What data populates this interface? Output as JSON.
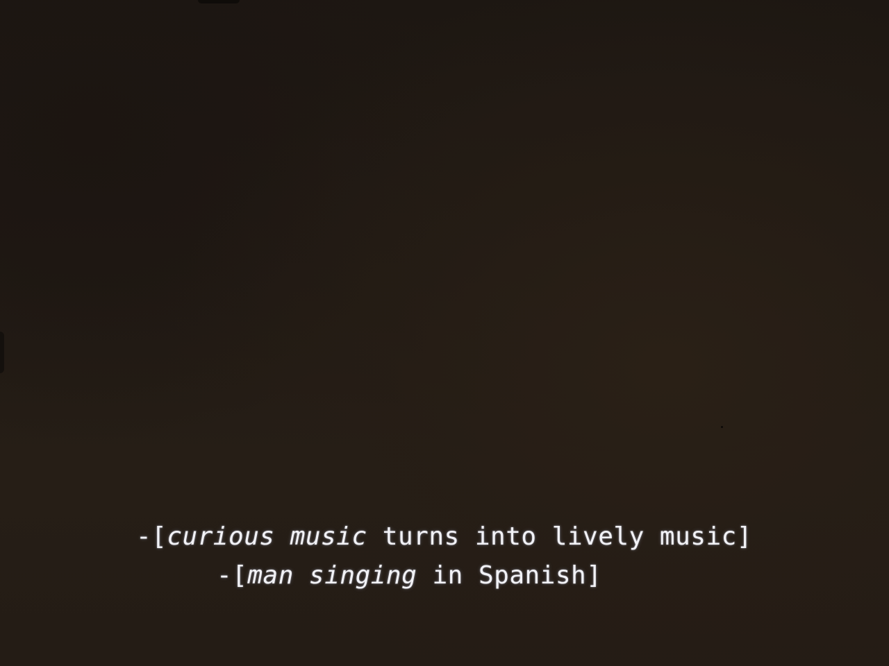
{
  "subtitles": {
    "line_1": {
      "prefix": "-[",
      "italic_part": "curious music",
      "rest": " turns into lively music]"
    },
    "line_2": {
      "prefix": "-[",
      "italic_part": "man singing",
      "rest": " in Spanish]"
    }
  },
  "colors": {
    "background": "#221b15",
    "subtitle_text": "#f2f2f6"
  }
}
